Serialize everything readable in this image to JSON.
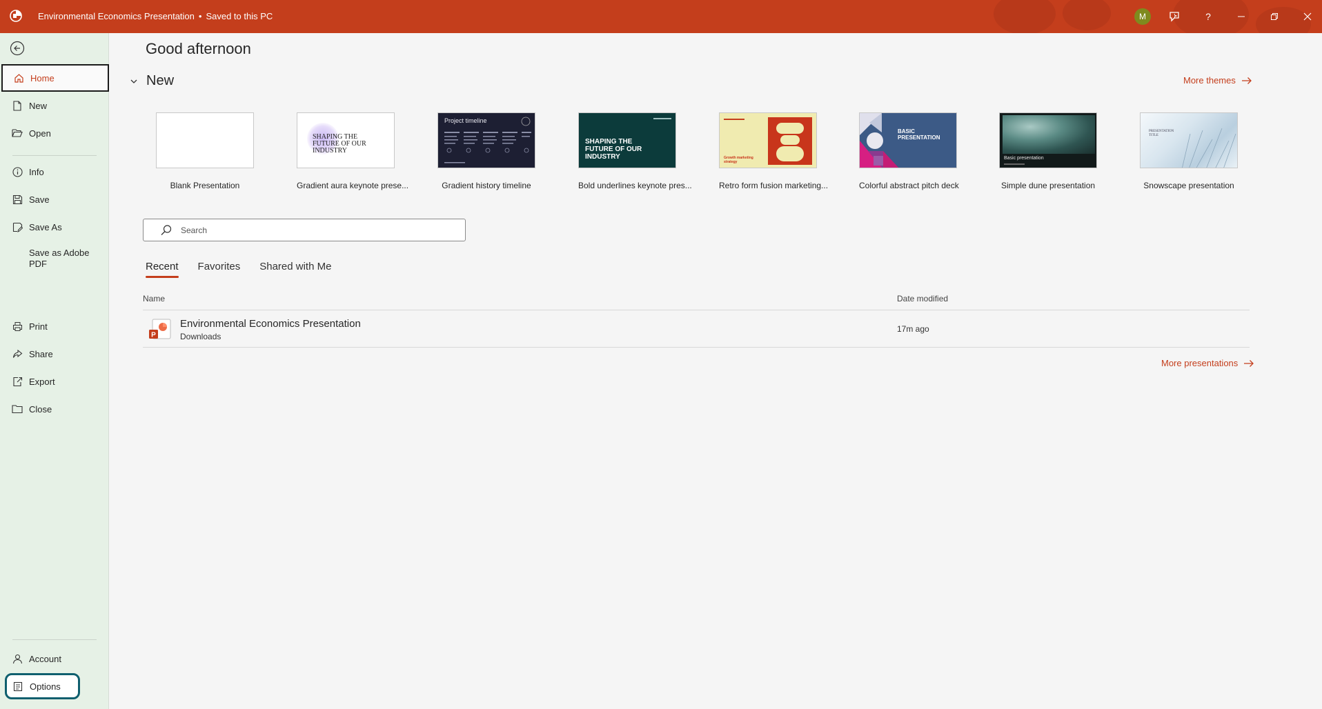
{
  "app": {
    "document_title": "Environmental Economics Presentation",
    "save_status": "Saved to this PC",
    "separator": "•",
    "user_initial": "M",
    "accent_color": "#c43e1c"
  },
  "sidebar": {
    "items": [
      {
        "label": "Home"
      },
      {
        "label": "New"
      },
      {
        "label": "Open"
      },
      {
        "label": "Info"
      },
      {
        "label": "Save"
      },
      {
        "label": "Save As"
      },
      {
        "label": "Save as Adobe PDF"
      },
      {
        "label": "Print"
      },
      {
        "label": "Share"
      },
      {
        "label": "Export"
      },
      {
        "label": "Close"
      }
    ],
    "bottom": [
      {
        "label": "Account"
      },
      {
        "label": "Options"
      }
    ]
  },
  "main": {
    "greeting": "Good afternoon",
    "new_section": {
      "heading": "New",
      "more_themes": "More themes",
      "templates": [
        {
          "name": "Blank Presentation"
        },
        {
          "name": "Gradient aura keynote prese...",
          "thumb_text": "SHAPING THE FUTURE OF OUR INDUSTRY"
        },
        {
          "name": "Gradient history timeline",
          "thumb_text": "Project timeline"
        },
        {
          "name": "Bold underlines keynote pres...",
          "thumb_text": "SHAPING THE FUTURE OF OUR INDUSTRY"
        },
        {
          "name": "Retro form fusion marketing...",
          "thumb_text": "Growth marketing strategy"
        },
        {
          "name": "Colorful abstract pitch deck",
          "thumb_text": "BASIC PRESENTATION"
        },
        {
          "name": "Simple dune presentation",
          "thumb_text": "Basic presentation"
        },
        {
          "name": "Snowscape presentation",
          "thumb_text": "PRESENTATION TITLE"
        }
      ]
    },
    "search": {
      "placeholder": "Search"
    },
    "tabs": [
      {
        "label": "Recent"
      },
      {
        "label": "Favorites"
      },
      {
        "label": "Shared with Me"
      }
    ],
    "table": {
      "columns": [
        "Name",
        "Date modified"
      ],
      "rows": [
        {
          "name": "Environmental Economics Presentation",
          "location": "Downloads",
          "modified": "17m ago"
        }
      ]
    },
    "more_presentations": "More presentations"
  }
}
